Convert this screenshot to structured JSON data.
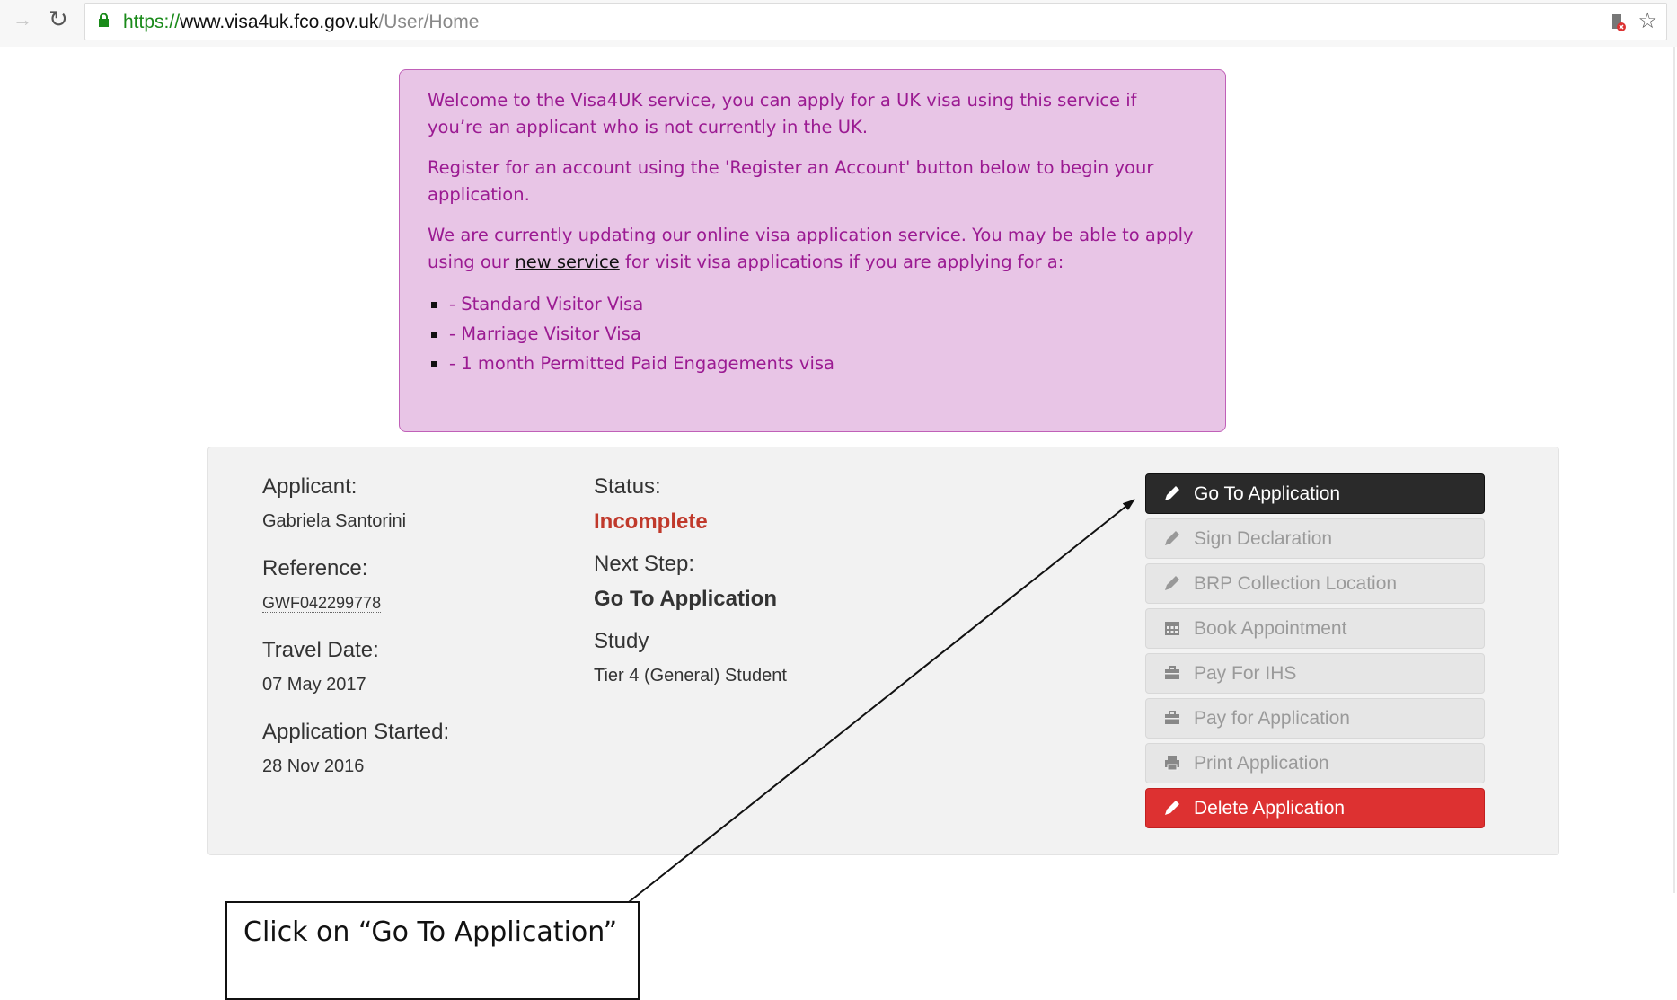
{
  "browser": {
    "url_scheme": "https://",
    "url_host": "www.visa4uk.fco.gov.uk",
    "url_path": "/User/Home",
    "forward_icon": "arrow-right-icon",
    "reload_icon": "reload-icon",
    "lock_icon": "lock-icon",
    "extension_icon": "shield-extension-icon",
    "bookmark_icon": "star-icon"
  },
  "notice": {
    "para1": "Welcome to the Visa4UK service, you can apply for a UK visa using this service if you’re an applicant who is not currently in the UK.",
    "para2": "Register for an account using the 'Register an Account' button below to begin your application.",
    "para3_before": "We are currently updating our online visa application service. You may be able to apply using our ",
    "para3_link": "new service",
    "para3_after": " for visit visa applications if you are applying for a:",
    "items": [
      "- Standard Visitor Visa",
      "- Marriage Visitor Visa",
      "- 1 month Permitted Paid Engagements visa"
    ]
  },
  "application": {
    "applicant_label": "Applicant:",
    "applicant_value": "Gabriela Santorini",
    "reference_label": "Reference:",
    "reference_value": "GWF042299778",
    "travel_label": "Travel Date:",
    "travel_value": "07 May 2017",
    "started_label": "Application Started:",
    "started_value": "28 Nov 2016",
    "status_label": "Status:",
    "status_value": "Incomplete",
    "nextstep_label": "Next Step:",
    "nextstep_value": "Go To Application",
    "study_label": "Study",
    "study_value": "Tier 4 (General) Student"
  },
  "actions": [
    {
      "label": "Go To Application",
      "icon": "pencil-icon",
      "enabled": true
    },
    {
      "label": "Sign Declaration",
      "icon": "pencil-icon",
      "enabled": false
    },
    {
      "label": "BRP Collection Location",
      "icon": "pencil-icon",
      "enabled": false
    },
    {
      "label": "Book Appointment",
      "icon": "calendar-icon",
      "enabled": false
    },
    {
      "label": "Pay For IHS",
      "icon": "briefcase-icon",
      "enabled": false
    },
    {
      "label": "Pay for Application",
      "icon": "briefcase-icon",
      "enabled": false
    },
    {
      "label": "Print Application",
      "icon": "print-icon",
      "enabled": false
    },
    {
      "label": "Delete Application",
      "icon": "pencil-icon",
      "enabled": true
    }
  ],
  "annotation": {
    "callout_text": "Click on “Go To Application”"
  },
  "colors": {
    "notice_bg": "#e8c5e6",
    "notice_text": "#9b1a92",
    "status_red": "#c0392b",
    "primary_dark": "#2a2a2a",
    "danger": "#dd3131"
  }
}
